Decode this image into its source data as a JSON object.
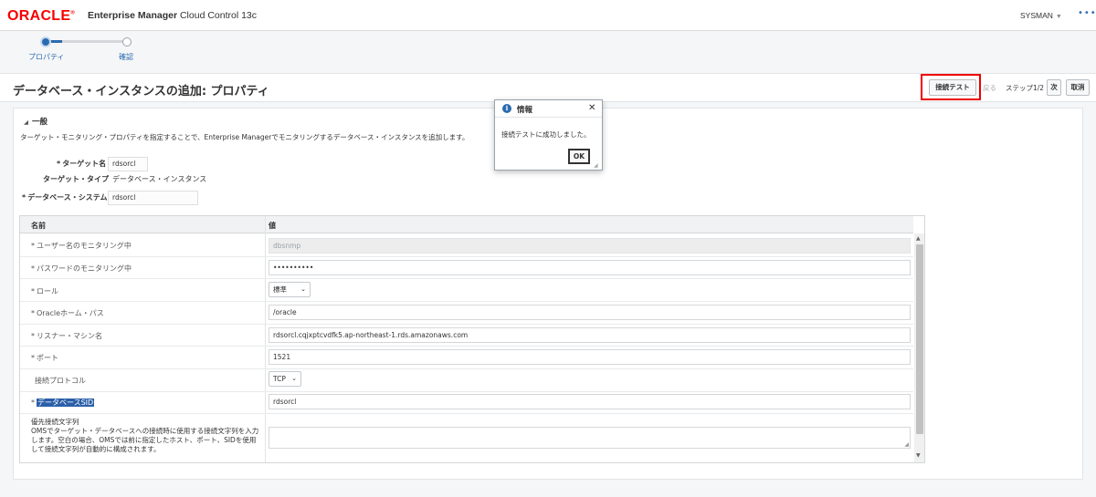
{
  "app": {
    "logo": "ORACLE",
    "product_bold": "Enterprise Manager",
    "product_rest": "Cloud Control 13c",
    "user": "SYSMAN",
    "more": "•••"
  },
  "train": {
    "steps": [
      {
        "label": "プロパティ"
      },
      {
        "label": "確認"
      }
    ]
  },
  "header": {
    "title": "データベース・インスタンスの追加: プロパティ",
    "test_button": "接続テスト",
    "back": "戻る",
    "step": "ステップ1/2",
    "next": "次",
    "cancel": "取消"
  },
  "general": {
    "section_title": "一般",
    "description": "ターゲット・モニタリング・プロパティを指定することで、Enterprise Managerでモニタリングするデータベース・インスタンスを追加します。",
    "target_name_label": "ターゲット名",
    "target_name_value": "rdsorcl",
    "target_type_label": "ターゲット・タイプ",
    "target_type_value": "データベース・インスタンス",
    "db_system_label": "データベース・システム",
    "db_system_value": "rdsorcl"
  },
  "grid": {
    "col_name": "名前",
    "col_value": "値",
    "rows": [
      {
        "label": "ユーザー名のモニタリング中",
        "value": "dbsnmp"
      },
      {
        "label": "パスワードのモニタリング中",
        "value": "••••••••••"
      },
      {
        "label": "ロール",
        "value": "標準"
      },
      {
        "label": "Oracleホーム・パス",
        "value": "/oracle"
      },
      {
        "label": "リスナー・マシン名",
        "value": "rdsorcl.cqjxptcvdfk5.ap-northeast-1.rds.amazonaws.com"
      },
      {
        "label": "ポート",
        "value": "1521"
      },
      {
        "label": "接続プロトコル",
        "value": "TCP"
      },
      {
        "label": "データベースSID",
        "value": "rdsorcl"
      }
    ],
    "pref_title": "優先接続文字列",
    "pref_desc": "OMSでターゲット・データベースへの接続時に使用する接続文字列を入力します。空白の場合、OMSでは前に指定したホスト、ポート、SIDを使用して接続文字列が自動的に構成されます。"
  },
  "dialog": {
    "title": "情報",
    "message": "接続テストに成功しました。",
    "ok": "OK"
  },
  "colors": {
    "oracle_red": "#f80000",
    "accent_blue": "#2b6cb0",
    "highlight_red": "#e00000"
  },
  "icons": {
    "info": "info-circle-icon",
    "close": "close-icon",
    "user_menu": "chevron-down-icon",
    "section_toggle": "triangle-down-icon"
  }
}
